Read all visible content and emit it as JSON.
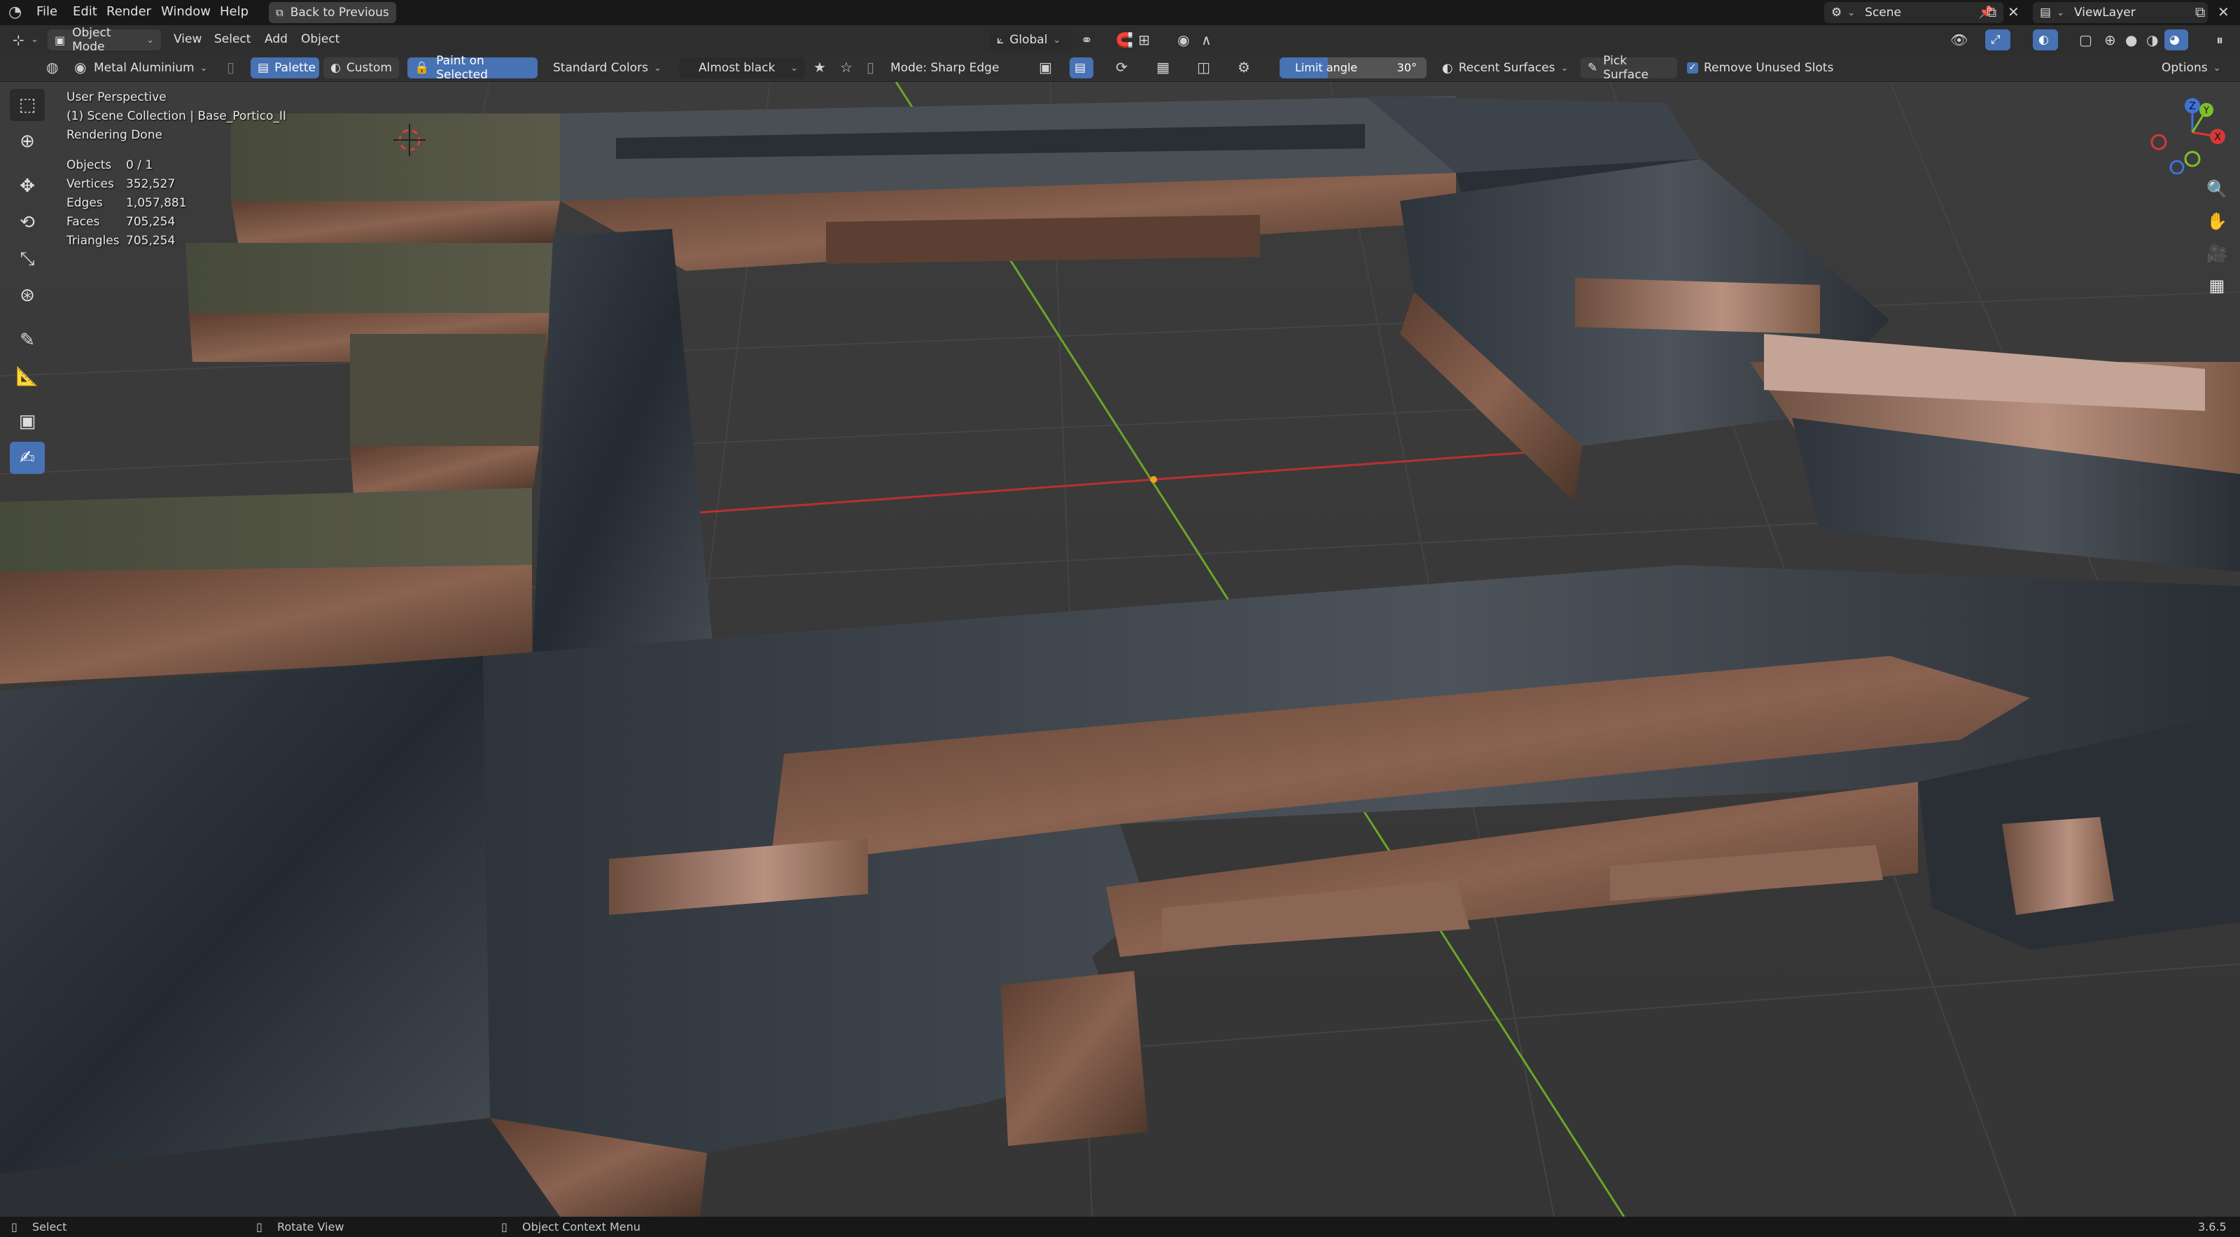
{
  "menu": {
    "items": [
      "File",
      "Edit",
      "Render",
      "Window",
      "Help"
    ],
    "back_button": "Back to Previous",
    "scene": "Scene",
    "view_layer": "ViewLayer"
  },
  "header": {
    "mode": "Object Mode",
    "menus": [
      "View",
      "Select",
      "Add",
      "Object"
    ],
    "transform_orientation": "Global"
  },
  "tool_header": {
    "material": "Metal Aluminium",
    "palette": "Palette",
    "custom": "Custom",
    "paint_on_selected": "Paint on Selected",
    "standard_colors": "Standard Colors",
    "color": "Almost black",
    "mode": "Mode: Sharp Edge",
    "limit_angle_label": "Limit angle",
    "limit_angle_value": "30°",
    "recent_surfaces": "Recent Surfaces",
    "pick_surface": "Pick Surface",
    "remove_unused_slots": "Remove Unused Slots",
    "options": "Options"
  },
  "viewport": {
    "perspective": "User Perspective",
    "collection": "(1) Scene Collection | Base_Portico_II",
    "render_status": "Rendering Done",
    "stats": [
      {
        "label": "Objects",
        "value": "0 / 1"
      },
      {
        "label": "Vertices",
        "value": "352,527"
      },
      {
        "label": "Edges",
        "value": "1,057,881"
      },
      {
        "label": "Faces",
        "value": "705,254"
      },
      {
        "label": "Triangles",
        "value": "705,254"
      }
    ],
    "gizmo_axes": [
      "Z",
      "Y",
      "X"
    ]
  },
  "status_bar": {
    "select": "Select",
    "rotate": "Rotate View",
    "context_menu": "Object Context Menu",
    "version": "3.6.5"
  },
  "colors": {
    "accent": "#4772b3",
    "x_axis": "#d63838",
    "y_axis": "#7fbf2a",
    "z_axis": "#3d74d6",
    "metal_copper": "#7a5440",
    "metal_dark": "#2d3238"
  }
}
